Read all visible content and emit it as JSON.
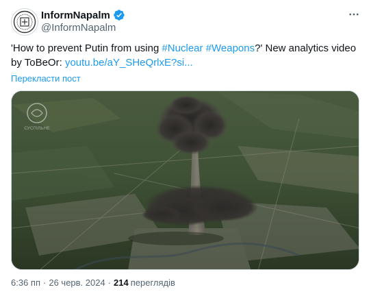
{
  "author": {
    "display_name": "InformNapalm",
    "handle": "@InformNapalm",
    "verified_icon": "verified-badge-icon",
    "accent": "#1d9bf0"
  },
  "tweet": {
    "text_before_tag1": "'How to prevent Putin from using ",
    "hashtag1": "#Nuclear",
    "space": " ",
    "hashtag2": "#Weapons",
    "text_after_tags": "?' New analytics video by ToBeOr: ",
    "link": "youtu.be/aY_SHeQrlxE?si...",
    "translate_label": "Перекласти пост"
  },
  "media": {
    "watermark_text": "СУСПІЛЬНЕ"
  },
  "meta": {
    "time": "6:36 пп",
    "separator": "·",
    "date": "26 черв. 2024",
    "views_count": "214",
    "views_label": "переглядів"
  }
}
